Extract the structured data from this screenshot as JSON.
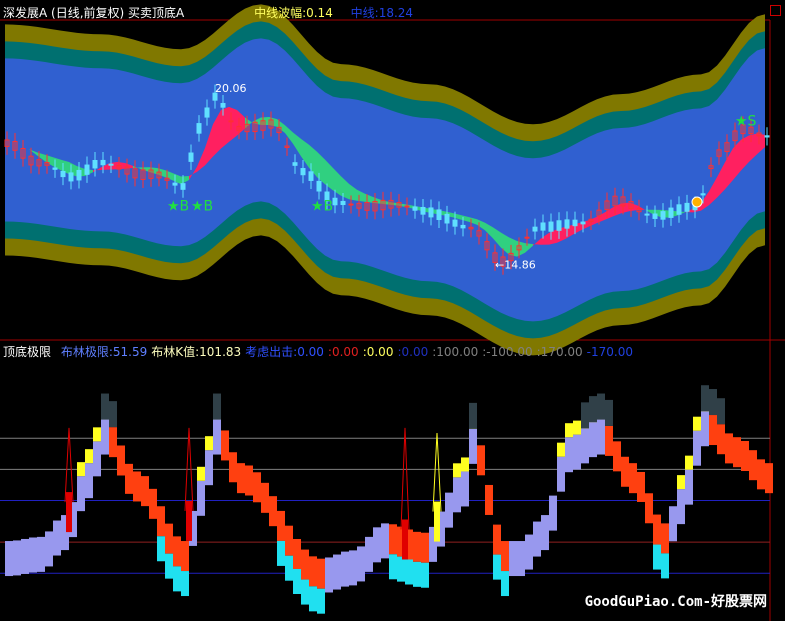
{
  "header_top": {
    "title": "深发展A (日线,前复权) 买卖顶底A",
    "mid_amp_label": "中线波幅:0.14",
    "mid_label": "中线:18.24"
  },
  "header_bottom": {
    "title": "顶底极限",
    "items": [
      {
        "text": "布林极限:51.59",
        "color": "#5f7fff"
      },
      {
        "text": "布林K值:101.83",
        "color": "#ffffc0"
      },
      {
        "text": "考虑出击:0.00",
        "color": "#3050ff"
      },
      {
        "text": ":0.00",
        "color": "#e02020"
      },
      {
        "text": ":0.00",
        "color": "#ffff60"
      },
      {
        "text": ":0.00",
        "color": "#2030c0"
      },
      {
        "text": ":100.00",
        "color": "#808080"
      },
      {
        "text": ":-100.00",
        "color": "#808080"
      },
      {
        "text": ":170.00",
        "color": "#808080"
      },
      {
        "text": "-170.00",
        "color": "#2040e0"
      }
    ]
  },
  "watermark": "GoodGuPiao.Com-好股票网",
  "colors": {
    "outer": "#807800",
    "middle": "#007070",
    "inner": "#3060d0",
    "up": "#ff2060",
    "down": "#30d080",
    "lavender": "#9898ee",
    "orange": "#ff4010",
    "cyan": "#20e0f0",
    "yellow": "#ffff20",
    "dark": "#304048",
    "spike": "#e00000"
  },
  "chart_data": [
    {
      "type": "candlestick",
      "title": "买卖顶底A",
      "bars": 96,
      "ylim": [
        12.7,
        22.06
      ],
      "midline": [
        [
          0,
          18.53
        ],
        [
          12,
          18.24
        ],
        [
          22,
          17.8
        ],
        [
          32,
          19.12
        ],
        [
          42,
          17.36
        ],
        [
          53,
          16.77
        ],
        [
          66,
          15.59
        ],
        [
          77,
          16.48
        ],
        [
          87,
          17.06
        ],
        [
          95,
          18.83
        ]
      ],
      "band_half_widths": [
        2.4,
        2.9,
        3.4
      ],
      "close": [
        [
          0,
          18.53
        ],
        [
          4,
          17.8
        ],
        [
          8,
          17.36
        ],
        [
          12,
          17.94
        ],
        [
          18,
          17.5
        ],
        [
          22,
          17.06
        ],
        [
          24,
          18.83
        ],
        [
          26,
          19.85
        ],
        [
          29,
          18.97
        ],
        [
          33,
          18.97
        ],
        [
          37,
          17.5
        ],
        [
          41,
          16.77
        ],
        [
          47,
          16.62
        ],
        [
          53,
          16.33
        ],
        [
          58,
          16.04
        ],
        [
          62,
          14.95
        ],
        [
          67,
          15.89
        ],
        [
          72,
          16.18
        ],
        [
          76,
          16.77
        ],
        [
          81,
          16.18
        ],
        [
          86,
          16.62
        ],
        [
          89,
          18.24
        ],
        [
          92,
          18.83
        ],
        [
          95,
          18.53
        ]
      ],
      "annotations": [
        {
          "text": "20.06",
          "bar": 26,
          "price": 20.06
        },
        {
          "text": "←14.86",
          "bar": 61,
          "price": 14.86
        }
      ],
      "signals": [
        {
          "type": "B",
          "bar": 21,
          "price": 16.6
        },
        {
          "type": "B",
          "bar": 24,
          "price": 16.6
        },
        {
          "type": "B",
          "bar": 39,
          "price": 16.6
        },
        {
          "type": "S",
          "bar": 92,
          "price": 19.1
        }
      ]
    },
    {
      "type": "bar",
      "title": "顶底极限",
      "bars": 96,
      "ylim": [
        -76,
        184
      ],
      "reference_lines": [
        {
          "value": 100,
          "color": "#808080"
        },
        {
          "value": 70,
          "color": "#808080"
        },
        {
          "value": 40,
          "color": "#2020c0"
        },
        {
          "value": 0,
          "color": "#902020"
        },
        {
          "value": -30,
          "color": "#2020c0"
        }
      ],
      "k": [
        [
          0,
          1
        ],
        [
          4,
          5
        ],
        [
          7,
          26
        ],
        [
          10,
          76
        ],
        [
          12,
          118
        ],
        [
          16,
          68
        ],
        [
          22,
          1
        ],
        [
          24,
          59
        ],
        [
          26,
          118
        ],
        [
          29,
          76
        ],
        [
          39,
          -16
        ],
        [
          43,
          -8
        ],
        [
          47,
          18
        ],
        [
          52,
          9
        ],
        [
          57,
          68
        ],
        [
          58,
          109
        ],
        [
          62,
          1
        ],
        [
          64,
          1
        ],
        [
          67,
          26
        ],
        [
          70,
          101
        ],
        [
          74,
          118
        ],
        [
          78,
          76
        ],
        [
          82,
          18
        ],
        [
          84,
          51
        ],
        [
          87,
          126
        ],
        [
          91,
          101
        ],
        [
          95,
          76
        ]
      ],
      "spikes": [
        {
          "bar": 8,
          "value": 110,
          "color": "#e00000"
        },
        {
          "bar": 23,
          "value": 110,
          "color": "#e00000"
        },
        {
          "bar": 50,
          "value": 110,
          "color": "#e00000"
        },
        {
          "bar": 54,
          "value": 105,
          "color": "#ffff20"
        }
      ]
    }
  ]
}
